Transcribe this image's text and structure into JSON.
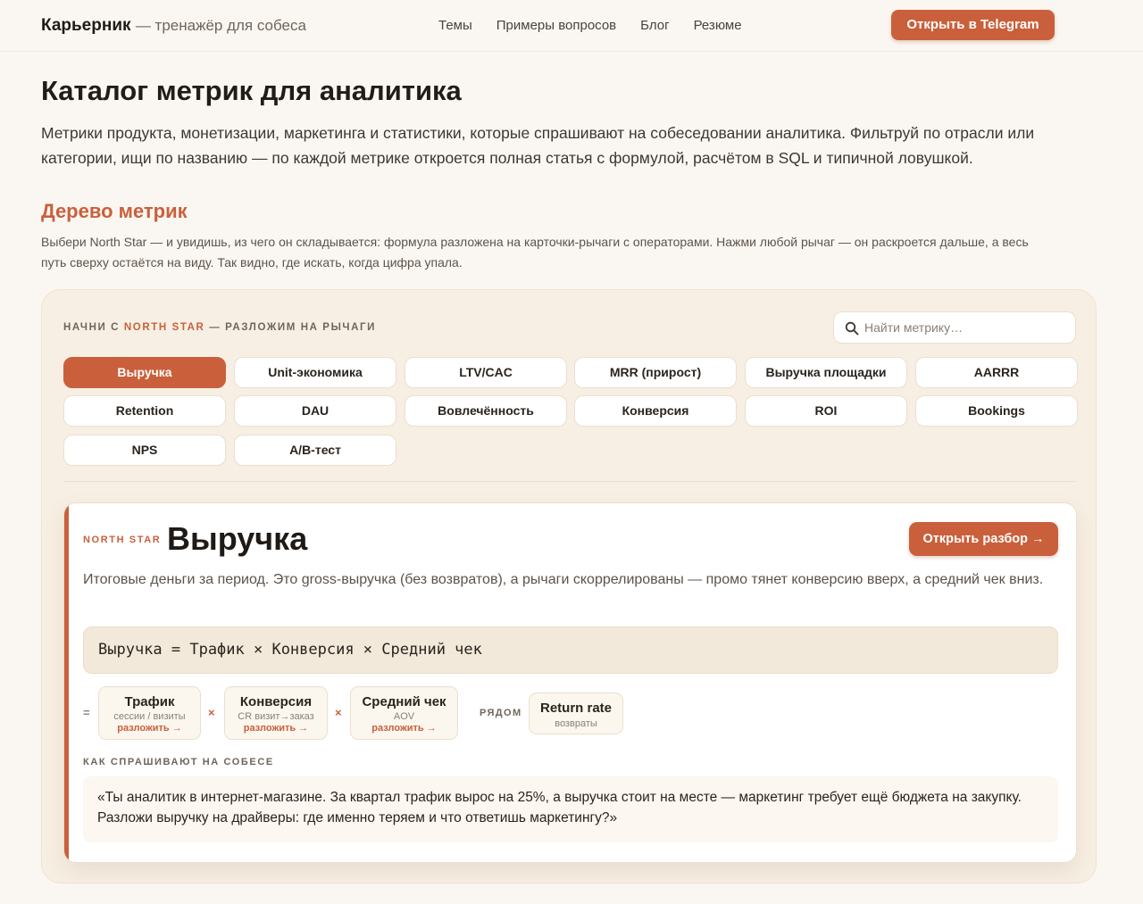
{
  "header": {
    "brand": "Карьерник",
    "tagline": "— тренажёр для собеса",
    "nav": [
      "Темы",
      "Примеры вопросов",
      "Блог",
      "Резюме"
    ],
    "cta": "Открыть в Telegram"
  },
  "page": {
    "title": "Каталог метрик для аналитика",
    "lead": "Метрики продукта, монетизации, маркетинга и статистики, которые спрашивают на собеседовании аналитика. Фильтруй по отрасли или категории, ищи по названию — по каждой метрике откроется полная статья с формулой, расчётом в SQL и типичной ловушкой."
  },
  "tree": {
    "title": "Дерево метрик",
    "lead": "Выбери North Star — и увидишь, из чего он складывается: формула разложена на карточки-рычаги с операторами. Нажми любой рычаг — он раскроется дальше, а весь путь сверху остаётся на виду. Так видно, где искать, когда цифра упала.",
    "eyebrow_prefix": "НАЧНИ С",
    "eyebrow_accent": "NORTH STAR",
    "eyebrow_suffix": "— РАЗЛОЖИМ НА РЫЧАГИ",
    "search_placeholder": "Найти метрику…",
    "chips": [
      "Выручка",
      "Unit-экономика",
      "LTV/CAC",
      "MRR (прирост)",
      "Выручка площадки",
      "AARRR",
      "Retention",
      "DAU",
      "Вовлечённость",
      "Конверсия",
      "ROI",
      "Bookings",
      "NPS",
      "A/B-тест"
    ],
    "active_chip": "Выручка"
  },
  "card": {
    "label": "NORTH STAR",
    "title": "Выручка",
    "open_button": "Открыть разбор →",
    "description": "Итоговые деньги за период. Это gross-выручка (без возвратов), а рычаги скоррелированы — промо тянет конверсию вверх, а средний чек вниз.",
    "formula": "Выручка = Трафик × Конверсия × Средний чек",
    "eq_symbol": "=",
    "times_symbol": "×",
    "levers": [
      {
        "name": "Трафик",
        "sub": "сессии / визиты",
        "link": "разложить →"
      },
      {
        "name": "Конверсия",
        "sub": "CR визит→заказ",
        "link": "разложить →"
      },
      {
        "name": "Средний чек",
        "sub": "AOV",
        "link": "разложить →"
      }
    ],
    "beside_label": "РЯДОМ",
    "side_lever": {
      "name": "Return rate",
      "sub": "возвраты"
    },
    "ask_label": "КАК СПРАШИВАЮТ НА СОБЕСЕ",
    "quote": "«Ты аналитик в интернет-магазине. За квартал трафик вырос на 25%, а выручка стоит на месте — маркетинг требует ещё бюджета на закупку. Разложи выручку на драйверы: где именно теряем и что ответишь маркетингу?»"
  },
  "colors": {
    "accent": "#c9603b",
    "page_bg": "#faf7f2",
    "panel_bg": "#f7efe3"
  }
}
